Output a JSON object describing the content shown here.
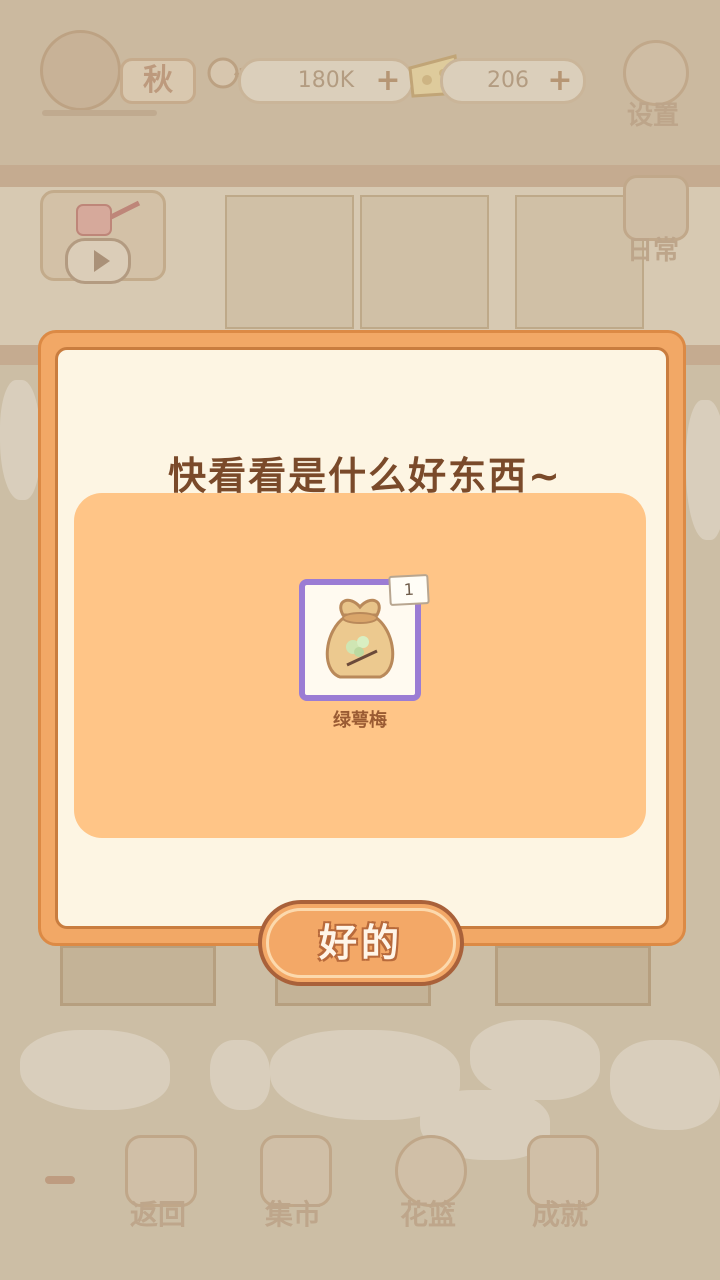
{
  "hud": {
    "season_label": "秋",
    "fish_value": "180K",
    "cheese_value": "206",
    "plus_symbol": "+"
  },
  "side_buttons": {
    "settings_label": "设置",
    "daily_label": "日常"
  },
  "bottom_nav": {
    "back_label": "返回",
    "market_label": "集市",
    "basket_label": "花篮",
    "achievement_label": "成就"
  },
  "dialog": {
    "title": "快看看是什么好东西~",
    "item": {
      "name": "绿萼梅",
      "count": "1",
      "icon": "seed-bag-icon"
    },
    "confirm_label": "好的"
  },
  "colors": {
    "dialog_border": "#f2a866",
    "panel": "#ffc587",
    "item_frame": "#9b7cd4",
    "title_text": "#7a4a2a"
  }
}
